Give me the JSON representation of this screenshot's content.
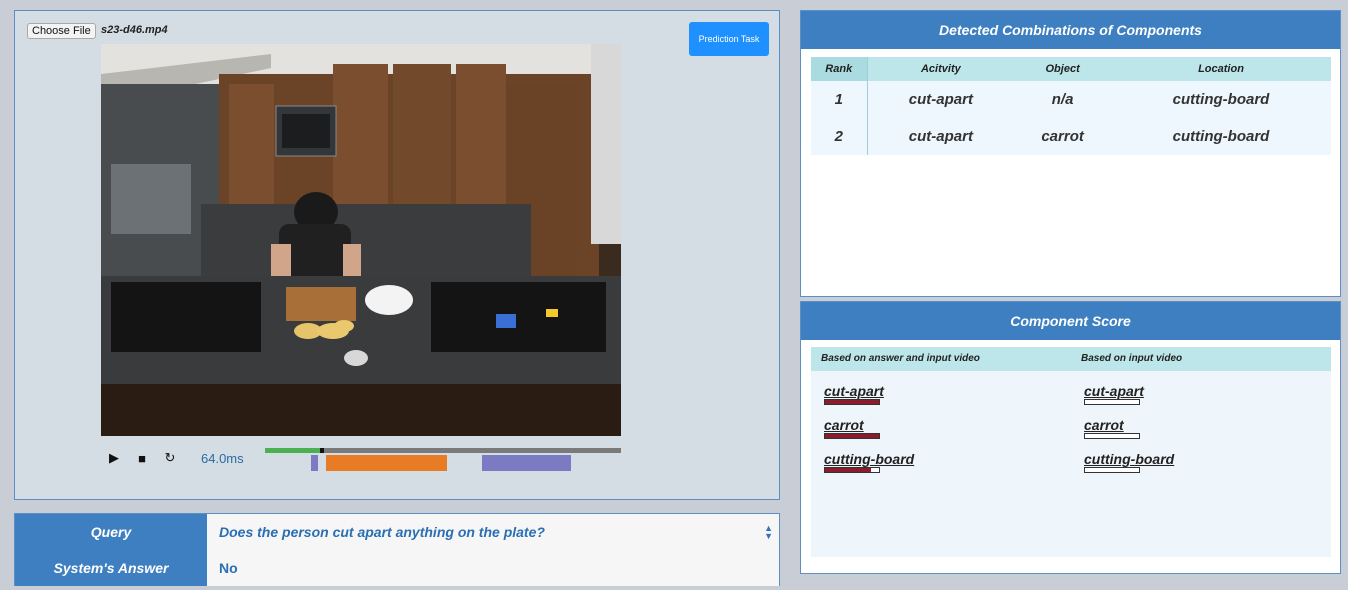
{
  "file_input": {
    "button_label": "Choose File",
    "file_name": "s23-d46.mp4"
  },
  "prediction_button": {
    "label": "Prediction Task"
  },
  "player": {
    "time_readout": "64.0ms",
    "progress": 0.16,
    "segments": [
      {
        "color": "#7b7bc4",
        "start": 0.13,
        "end": 0.15
      },
      {
        "color": "#e87c24",
        "start": 0.17,
        "end": 0.51
      },
      {
        "color": "#7b7bc4",
        "start": 0.61,
        "end": 0.86
      }
    ]
  },
  "qa": {
    "query_label": "Query",
    "query_value": "Does the person cut apart anything on the plate?",
    "answer_label": "System's Answer",
    "answer_value": "No"
  },
  "combinations": {
    "title": "Detected Combinations of Components",
    "headers": {
      "rank": "Rank",
      "activity": "Acitvity",
      "object": "Object",
      "location": "Location"
    },
    "rows": [
      {
        "rank": "1",
        "activity": "cut-apart",
        "object": "n/a",
        "location": "cutting-board"
      },
      {
        "rank": "2",
        "activity": "cut-apart",
        "object": "carrot",
        "location": "cutting-board"
      }
    ]
  },
  "component_score": {
    "title": "Component Score",
    "col_left": "Based on answer and input video",
    "col_right": "Based on input video",
    "left": [
      {
        "label": "cut-apart",
        "score": 1.0
      },
      {
        "label": "carrot",
        "score": 1.0
      },
      {
        "label": "cutting-board",
        "score": 0.85
      }
    ],
    "right": [
      {
        "label": "cut-apart",
        "score": 0.0
      },
      {
        "label": "carrot",
        "score": 0.0
      },
      {
        "label": "cutting-board",
        "score": 0.0
      }
    ]
  },
  "colors": {
    "accent": "#3d7fc0",
    "button_blue": "#1e90ff",
    "score_fill": "#8b1c2c"
  }
}
